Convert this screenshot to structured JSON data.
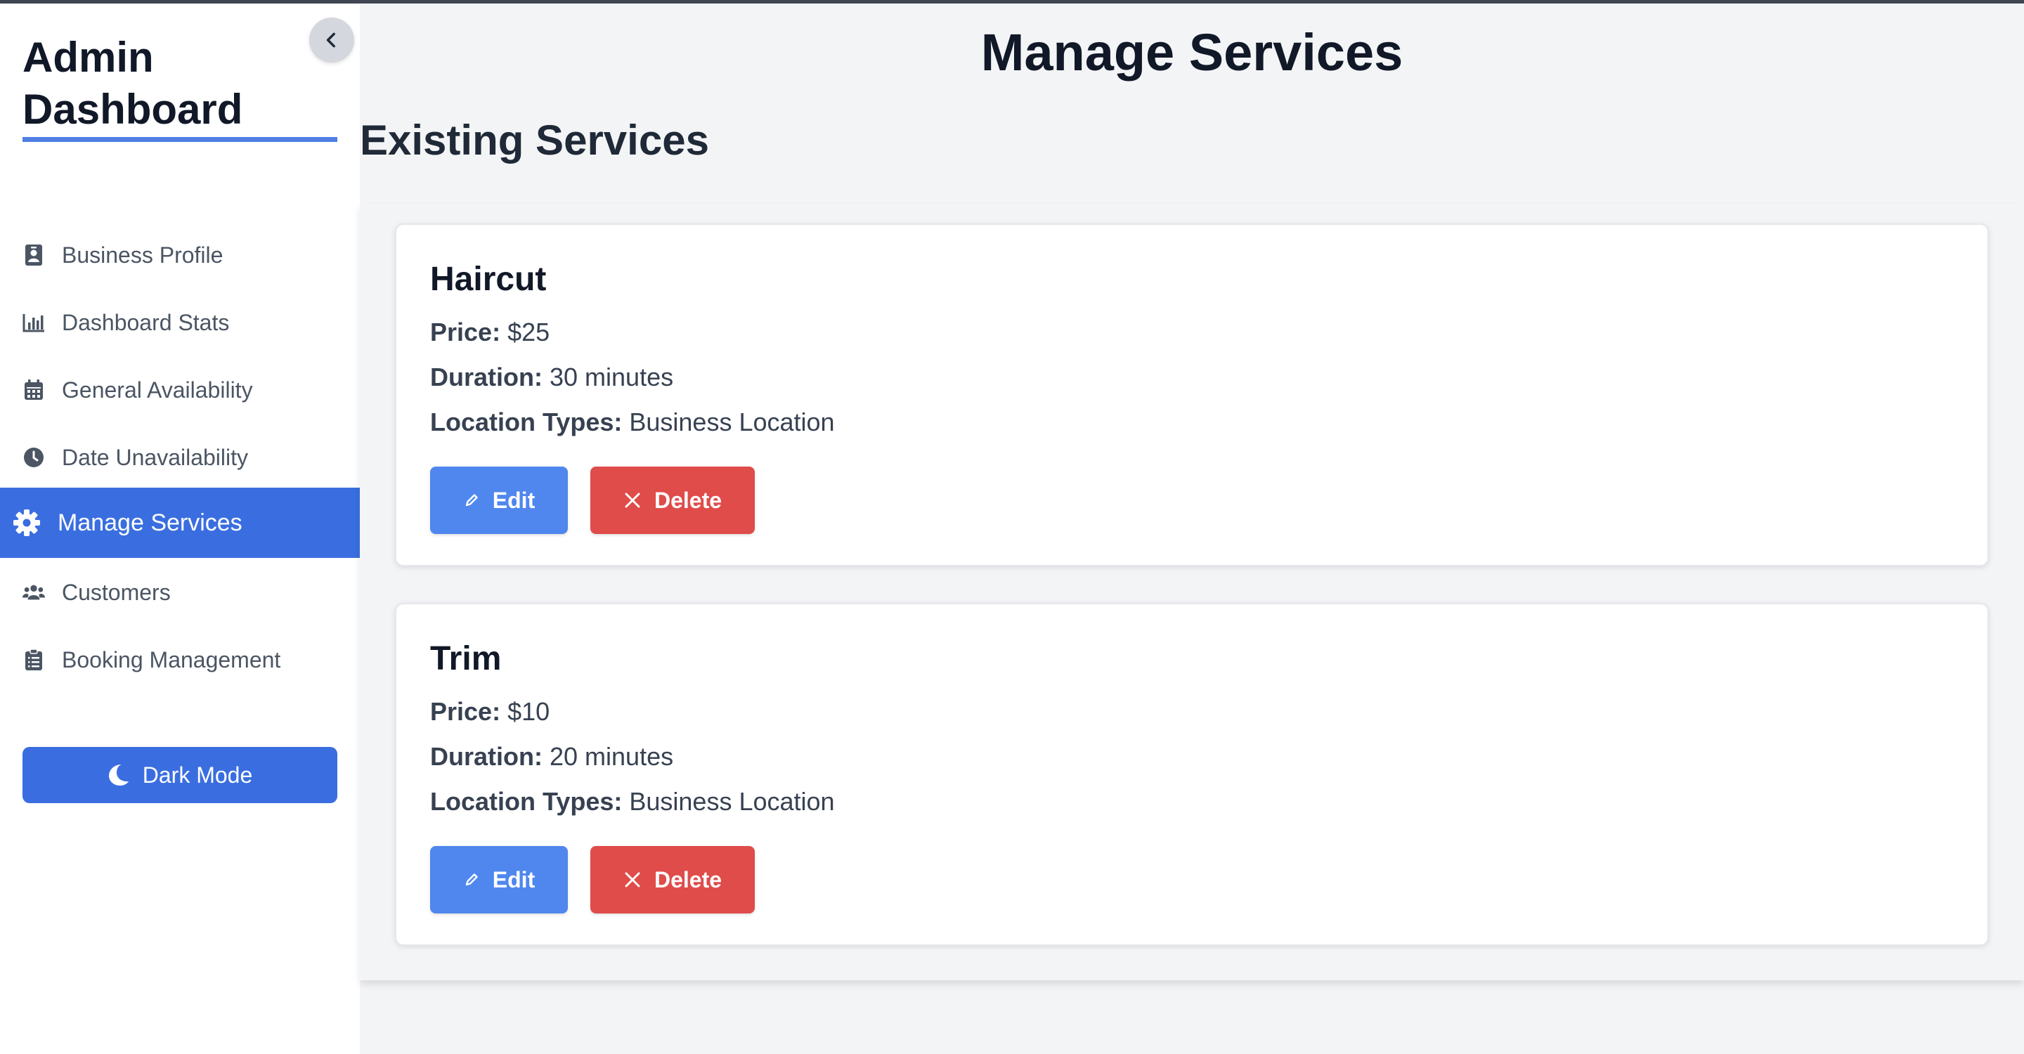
{
  "sidebar": {
    "title": "Admin Dashboard",
    "nav": [
      {
        "label": "Business Profile",
        "icon": "id-badge-icon"
      },
      {
        "label": "Dashboard Stats",
        "icon": "bar-chart-icon"
      },
      {
        "label": "General Availability",
        "icon": "calendar-icon"
      },
      {
        "label": "Date Unavailability",
        "icon": "clock-icon"
      },
      {
        "label": "Manage Services",
        "icon": "gear-icon",
        "active": true
      },
      {
        "label": "Customers",
        "icon": "users-icon"
      },
      {
        "label": "Booking Management",
        "icon": "clipboard-icon"
      }
    ],
    "dark_mode_label": "Dark Mode"
  },
  "main": {
    "title": "Manage Services",
    "section_title": "Existing Services",
    "services": [
      {
        "name": "Haircut",
        "price_label": "Price:",
        "price": "$25",
        "duration_label": "Duration:",
        "duration": "30 minutes",
        "location_label": "Location Types:",
        "location": "Business Location",
        "edit_label": "Edit",
        "delete_label": "Delete"
      },
      {
        "name": "Trim",
        "price_label": "Price:",
        "price": "$10",
        "duration_label": "Duration:",
        "duration": "20 minutes",
        "location_label": "Location Types:",
        "location": "Business Location",
        "edit_label": "Edit",
        "delete_label": "Delete"
      }
    ]
  },
  "colors": {
    "primary": "#3a6ee0",
    "edit_button": "#4f87ee",
    "delete_button": "#df4c4a",
    "page_background": "#f3f4f6"
  }
}
